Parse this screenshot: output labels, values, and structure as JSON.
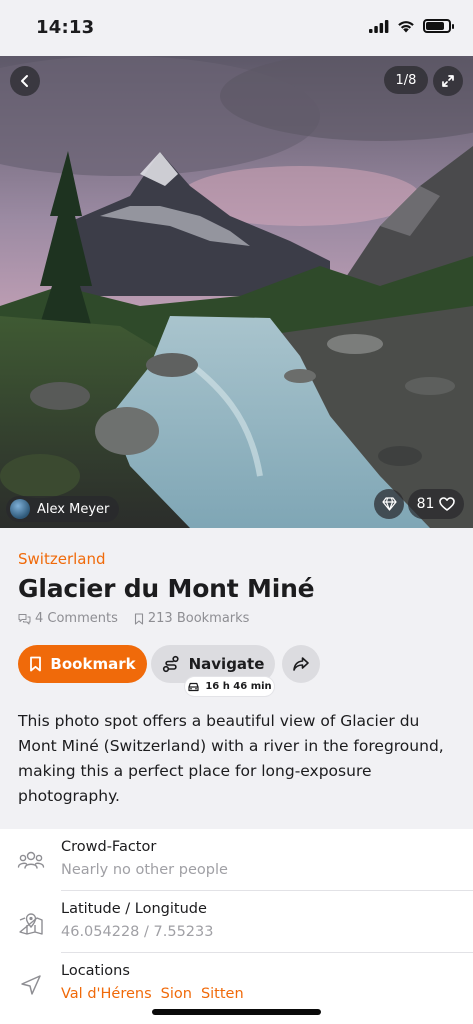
{
  "status_bar": {
    "time": "14:13"
  },
  "photo": {
    "counter": "1/8",
    "author": "Alex Meyer",
    "likes": "81"
  },
  "spot": {
    "country": "Switzerland",
    "title": "Glacier du Mont Miné",
    "comments": "4 Comments",
    "bookmarks": "213 Bookmarks"
  },
  "actions": {
    "bookmark_label": "Bookmark",
    "navigate_label": "Navigate",
    "drive_time": "16 h 46 min"
  },
  "description": "This photo spot offers a beautiful view of Glacier du Mont Miné (Switzerland) with a river in the foreground, making this a perfect place for long-exposure photography.",
  "details": {
    "crowd": {
      "label": "Crowd-Factor",
      "value": "Nearly no other people"
    },
    "coords": {
      "label": "Latitude / Longitude",
      "value": "46.054228 / 7.55233"
    },
    "locations": {
      "label": "Locations",
      "items": [
        "Val d'Hérens",
        "Sion",
        "Sitten"
      ]
    }
  },
  "colors": {
    "accent": "#f06a0a",
    "background": "#f1f1f4"
  },
  "icons": [
    "back-arrow-icon",
    "expand-icon",
    "gem-icon",
    "heart-icon",
    "comment-icon",
    "bookmark-icon",
    "route-icon",
    "car-icon",
    "share-icon",
    "people-icon",
    "map-pin-icon",
    "navigation-arrow-icon"
  ]
}
